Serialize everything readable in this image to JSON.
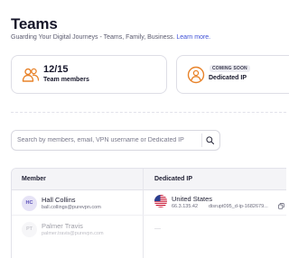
{
  "page": {
    "title": "Teams",
    "subtitle": "Guarding Your Digital Journeys - Teams, Family, Business.",
    "learn_more": "Learn more."
  },
  "cards": {
    "members": {
      "value": "12/15",
      "label": "Team members",
      "icon": "users-icon"
    },
    "dedicated_ip": {
      "badge": "COMING SOON",
      "label": "Dedicated IP",
      "icon": "user-location-icon"
    }
  },
  "search": {
    "placeholder": "Search by members, email, VPN username or Dedicated IP",
    "icon": "search-icon"
  },
  "table": {
    "headers": [
      "Member",
      "Dedicated IP"
    ],
    "rows": [
      {
        "initials": "HC",
        "name": "Hall Collins",
        "email": "ball.collings@purevpn.com",
        "country": "United States",
        "ip": "66.3.135.42",
        "host": "disrupt095_d-ip-1682679...",
        "flag": "us-flag-icon"
      },
      {
        "initials": "PT",
        "name": "Palmer Travis",
        "email": "palmer.travis@purevpn.com",
        "dip": "—"
      }
    ]
  },
  "colors": {
    "accent": "#3d4fd6",
    "icon_orange": "#e8832a",
    "text_dark": "#16162a"
  }
}
